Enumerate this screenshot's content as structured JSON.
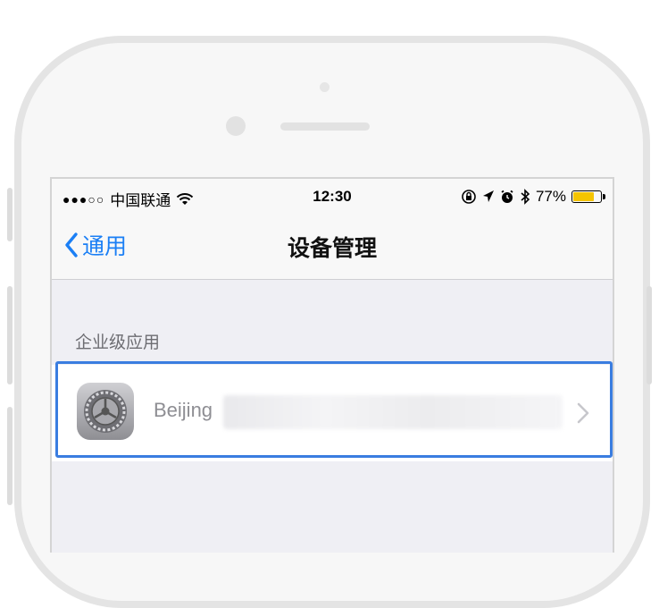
{
  "status_bar": {
    "signal": "●●●○○",
    "carrier": "中国联通",
    "time": "12:30",
    "battery_percent": "77%",
    "battery_level": 0.77,
    "icons": [
      "wifi-icon",
      "rotation-lock-icon",
      "location-icon",
      "alarm-icon",
      "bluetooth-icon",
      "battery-icon"
    ]
  },
  "nav": {
    "back_label": "通用",
    "title": "设备管理"
  },
  "section": {
    "header": "企业级应用"
  },
  "profile_row": {
    "label": "Beijing",
    "icon": "settings-gear-icon",
    "accessory": "chevron-right-icon"
  },
  "colors": {
    "ios_blue": "#1b7ff5",
    "highlight": "#3a7de0",
    "battery_fill": "#f5c400",
    "background": "#efeff4"
  }
}
